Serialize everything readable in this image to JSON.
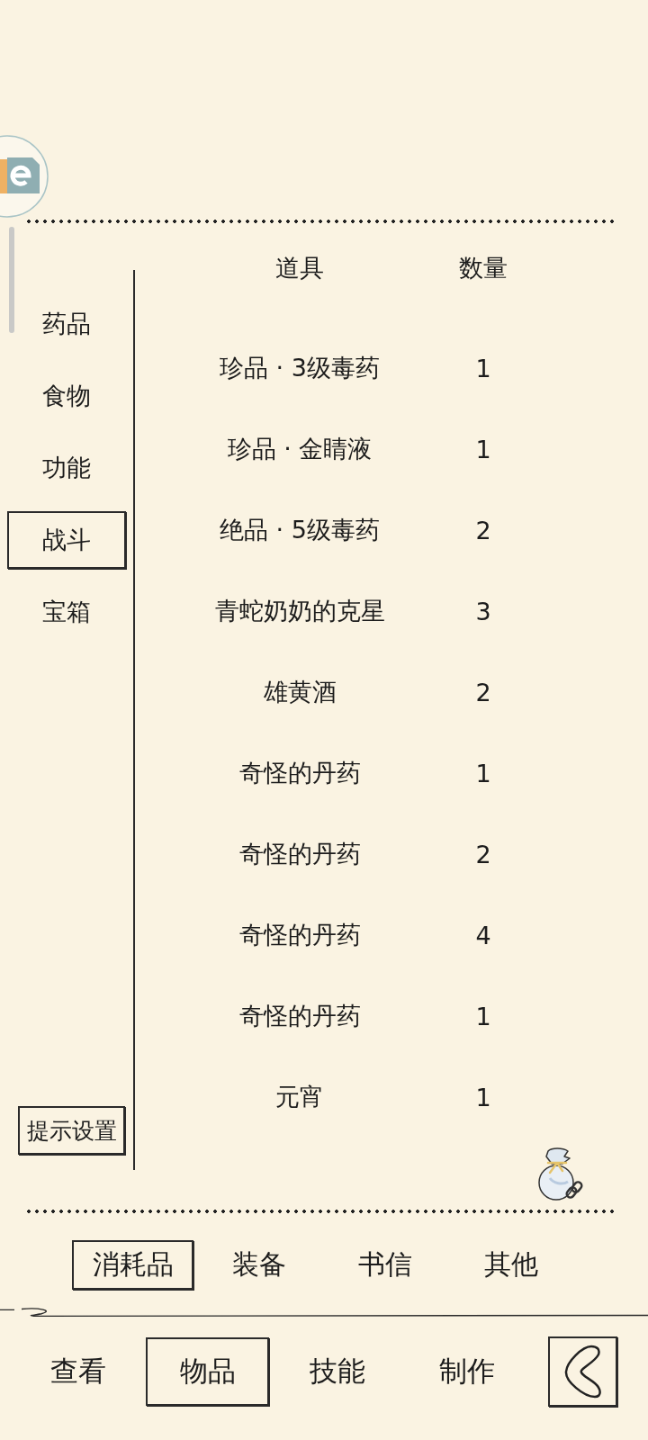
{
  "sidebar": {
    "items": [
      {
        "label": "药品",
        "selected": false
      },
      {
        "label": "食物",
        "selected": false
      },
      {
        "label": "功能",
        "selected": false
      },
      {
        "label": "战斗",
        "selected": true
      },
      {
        "label": "宝箱",
        "selected": false
      }
    ],
    "settings_button": "提示设置"
  },
  "table": {
    "columns": [
      "道具",
      "数量"
    ],
    "rows": [
      {
        "item": "珍品 · 3级毒药",
        "count": "1"
      },
      {
        "item": "珍品 · 金睛液",
        "count": "1"
      },
      {
        "item": "绝品 · 5级毒药",
        "count": "2"
      },
      {
        "item": "青蛇奶奶的克星",
        "count": "3"
      },
      {
        "item": "雄黄酒",
        "count": "2"
      },
      {
        "item": "奇怪的丹药",
        "count": "1"
      },
      {
        "item": "奇怪的丹药",
        "count": "2"
      },
      {
        "item": "奇怪的丹药",
        "count": "4"
      },
      {
        "item": "奇怪的丹药",
        "count": "1"
      },
      {
        "item": "元宵",
        "count": "1"
      }
    ]
  },
  "category_tabs": [
    {
      "label": "消耗品",
      "selected": true
    },
    {
      "label": "装备",
      "selected": false
    },
    {
      "label": "书信",
      "selected": false
    },
    {
      "label": "其他",
      "selected": false
    }
  ],
  "bottom_nav": [
    {
      "label": "查看",
      "selected": false
    },
    {
      "label": "物品",
      "selected": true
    },
    {
      "label": "技能",
      "selected": false
    },
    {
      "label": "制作",
      "selected": false
    }
  ]
}
